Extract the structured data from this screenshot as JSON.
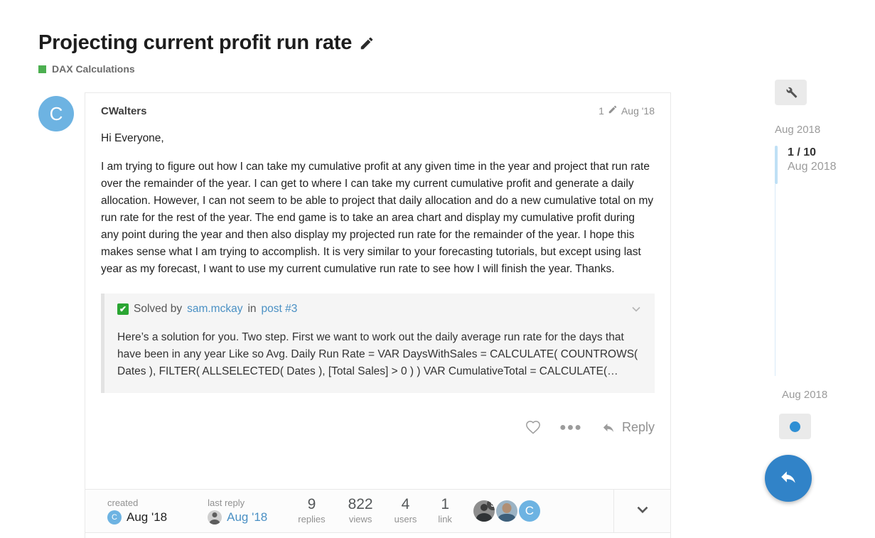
{
  "topic": {
    "title": "Projecting current profit run rate",
    "edit_icon": "pencil-icon",
    "category": "DAX Calculations",
    "category_color": "#4caf50"
  },
  "post": {
    "author": "CWalters",
    "avatar_letter": "C",
    "avatar_color": "#6db3e2",
    "edit_count": "1",
    "edit_icon": "pencil-icon",
    "date": "Aug '18",
    "paragraphs": [
      "Hi Everyone,",
      "I am trying to figure out how I can take my cumulative profit at any given time in the year and project that run rate over the remainder of the year. I can get to where I can take my current cumulative profit and generate a daily allocation. However, I can not seem to be able to project that daily allocation and do a new cumulative total on my run rate for the rest of the year. The end game is to take an area chart and display my cumulative profit during any point during the year and then also display my projected run rate for the remainder of the year. I hope this makes sense what I am trying to accomplish. It is very similar to your forecasting tutorials, but except using last year as my forecast, I want to use my current cumulative run rate to see how I will finish the year. Thanks."
    ]
  },
  "solved": {
    "check_icon": "checkmark-icon",
    "solved_label": "Solved by",
    "solver": "sam.mckay",
    "in_label": "in",
    "post_link": "post #3",
    "expand_icon": "chevron-down-icon",
    "excerpt": "Here’s a solution for you. Two step. First we want to work out the daily average run rate for the days that have been in any year Like so Avg. Daily Run Rate = VAR DaysWithSales = CALCULATE( COUNTROWS( Dates ), FILTER( ALLSELECTED( Dates ), [Total Sales] > 0 ) ) VAR CumulativeTotal = CALCULATE(…"
  },
  "post_controls": {
    "like_icon": "heart-icon",
    "more_icon": "ellipsis-icon",
    "reply_icon": "reply-arrow-icon",
    "reply_label": "Reply"
  },
  "topic_footer": {
    "created_label": "created",
    "created_date": "Aug '18",
    "created_avatar_letter": "C",
    "last_reply_label": "last reply",
    "last_reply_date": "Aug '18",
    "stats": [
      {
        "value": "9",
        "name": "replies"
      },
      {
        "value": "822",
        "name": "views"
      },
      {
        "value": "4",
        "name": "users"
      },
      {
        "value": "1",
        "name": "link"
      }
    ],
    "posters": [
      {
        "type": "photo",
        "badge": "5"
      },
      {
        "type": "photo",
        "badge": ""
      },
      {
        "type": "letter",
        "letter": "C",
        "badge": ""
      }
    ],
    "expand_icon": "chevron-down-icon"
  },
  "timeline": {
    "admin_icon": "wrench-icon",
    "top_date": "Aug 2018",
    "position": "1 / 10",
    "position_date": "Aug 2018",
    "bottom_date": "Aug 2018",
    "track_icon": "filled-circle-icon",
    "accent_color": "#3183c8"
  },
  "fab": {
    "icon": "reply-arrow-icon"
  }
}
